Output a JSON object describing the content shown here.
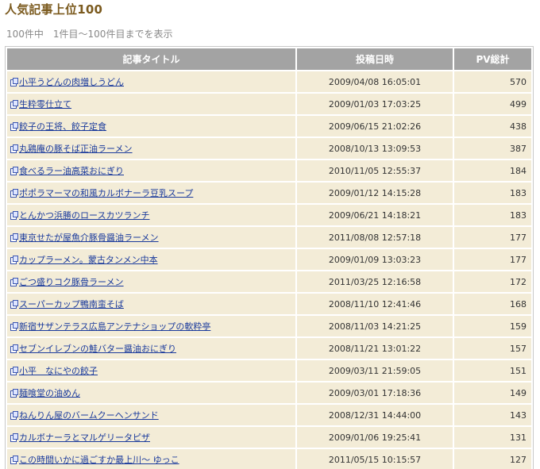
{
  "header": {
    "title": "人気記事上位100",
    "summary": "100件中　1件目～100件目までを表示"
  },
  "table": {
    "columns": [
      "記事タイトル",
      "投稿日時",
      "PV総計"
    ],
    "rows": [
      {
        "title": "小平うどんの肉増しうどん",
        "date": "2009/04/08 16:05:01",
        "pv": "570"
      },
      {
        "title": "生粋零仕立て",
        "date": "2009/01/03 17:03:25",
        "pv": "499"
      },
      {
        "title": "餃子の王将、餃子定食",
        "date": "2009/06/15 21:02:26",
        "pv": "438"
      },
      {
        "title": "丸鶏庵の豚そば正油ラーメン",
        "date": "2008/10/13 13:09:53",
        "pv": "387"
      },
      {
        "title": "食べるラー油高菜おにぎり",
        "date": "2010/11/05 12:55:37",
        "pv": "184"
      },
      {
        "title": "ポポラマーマの和風カルボナーラ豆乳スープ",
        "date": "2009/01/12 14:15:28",
        "pv": "183"
      },
      {
        "title": "とんかつ浜勝のロースカツランチ",
        "date": "2009/06/21 14:18:21",
        "pv": "183"
      },
      {
        "title": "東京せたが屋魚介豚骨醤油ラーメン",
        "date": "2011/08/08 12:57:18",
        "pv": "177"
      },
      {
        "title": "カップラーメン。蒙古タンメン中本",
        "date": "2009/01/09 13:03:23",
        "pv": "177"
      },
      {
        "title": "ごつ盛りコク豚骨ラーメン",
        "date": "2011/03/25 12:16:58",
        "pv": "172"
      },
      {
        "title": "スーパーカップ鴨南蛮そば",
        "date": "2008/11/10 12:41:46",
        "pv": "168"
      },
      {
        "title": "新宿サザンテラス広島アンテナショップの軟粋亭",
        "date": "2008/11/03 14:21:25",
        "pv": "159"
      },
      {
        "title": "セブンイレブンの鮭バター醤油おにぎり",
        "date": "2008/11/21 13:01:22",
        "pv": "157"
      },
      {
        "title": "小平　なにやの餃子",
        "date": "2009/03/11 21:59:05",
        "pv": "151"
      },
      {
        "title": "麺喰堂の油めん",
        "date": "2009/03/01 17:18:36",
        "pv": "149"
      },
      {
        "title": "ねんりん屋のバームクーヘンサンド",
        "date": "2008/12/31 14:44:00",
        "pv": "143"
      },
      {
        "title": "カルボナーラとマルゲリータピザ",
        "date": "2009/01/06 19:25:41",
        "pv": "131"
      },
      {
        "title": "この時間いかに過ごすか最上川～ ゆっこ",
        "date": "2011/05/15 10:15:57",
        "pv": "127"
      }
    ]
  }
}
